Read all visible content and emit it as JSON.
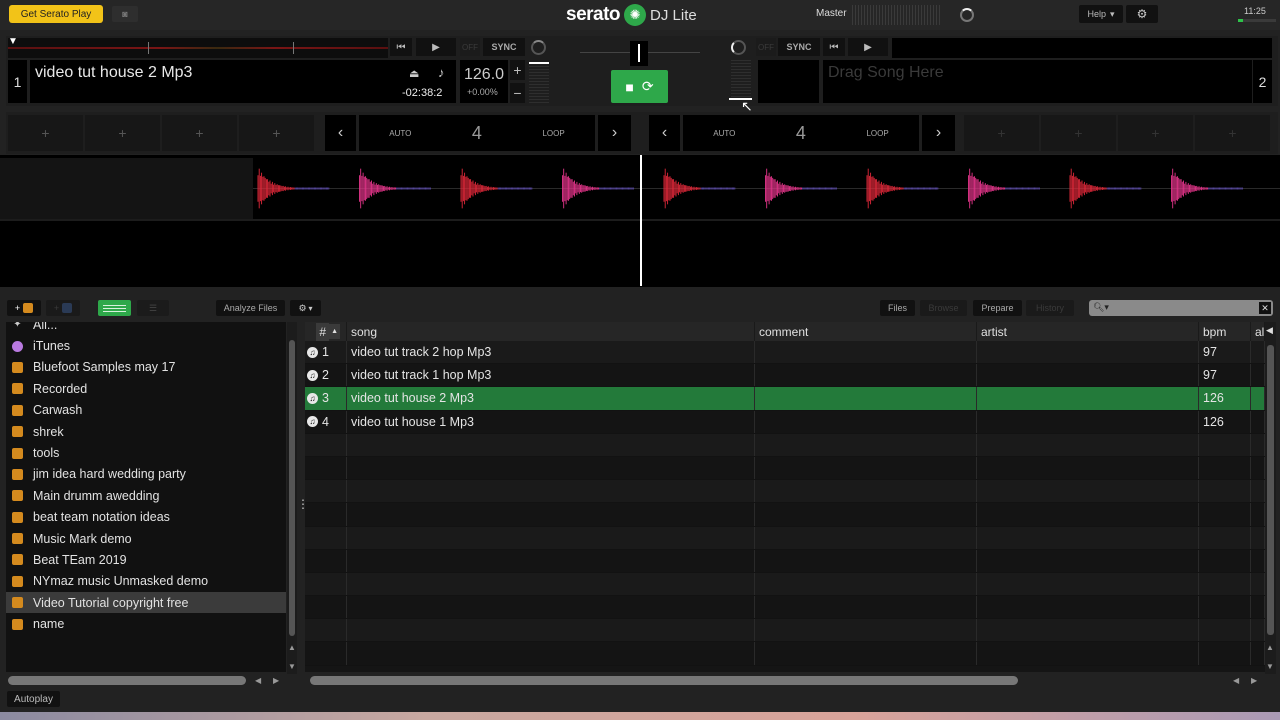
{
  "topbar": {
    "get_play_label": "Get Serato Play",
    "logo_brand": "serato",
    "logo_product": "DJ Lite",
    "master_label": "Master",
    "help_label": "Help",
    "clock": "11:25",
    "battery_level": 0.12
  },
  "deck1": {
    "number": "1",
    "title": "video tut house 2 Mp3",
    "time_remaining": "-02:38:2",
    "bpm": "126.0",
    "pitch": "+0.00%",
    "off_label": "OFF",
    "sync_label": "SYNC",
    "hotcues": [
      "+",
      "+",
      "+",
      "+"
    ],
    "loop": {
      "auto_label": "AUTO",
      "value": "4",
      "loop_label": "LOOP"
    }
  },
  "deck2": {
    "number": "2",
    "placeholder": "Drag Song Here",
    "off_label": "OFF",
    "sync_label": "SYNC",
    "hotcues": [
      "+",
      "+",
      "+",
      "+"
    ],
    "loop": {
      "auto_label": "AUTO",
      "value": "4",
      "loop_label": "LOOP"
    }
  },
  "crossfader": {
    "position": 0.5
  },
  "library_toolbar": {
    "analyze_label": "Analyze Files",
    "tabs": [
      {
        "label": "Files",
        "enabled": true
      },
      {
        "label": "Browse",
        "enabled": false
      },
      {
        "label": "Prepare",
        "enabled": true
      },
      {
        "label": "History",
        "enabled": false
      }
    ],
    "search_value": ""
  },
  "sidebar": {
    "items": [
      {
        "label": "All...",
        "icon": "all-icon"
      },
      {
        "label": "iTunes",
        "icon": "itunes-icon"
      },
      {
        "label": "Bluefoot Samples may 17",
        "icon": "crate-icon"
      },
      {
        "label": "Recorded",
        "icon": "crate-icon"
      },
      {
        "label": "Carwash",
        "icon": "crate-icon"
      },
      {
        "label": "shrek",
        "icon": "crate-icon"
      },
      {
        "label": "tools",
        "icon": "crate-icon"
      },
      {
        "label": "jim idea hard wedding party",
        "icon": "crate-icon"
      },
      {
        "label": "Main drumm awedding",
        "icon": "crate-icon"
      },
      {
        "label": "beat team notation ideas",
        "icon": "crate-icon"
      },
      {
        "label": "Music Mark demo",
        "icon": "crate-icon"
      },
      {
        "label": "Beat TEam 2019",
        "icon": "crate-icon"
      },
      {
        "label": "NYmaz music Unmasked demo",
        "icon": "crate-icon"
      },
      {
        "label": "Video Tutorial copyright free",
        "icon": "crate-icon",
        "selected": true
      },
      {
        "label": "name",
        "icon": "crate-icon"
      }
    ]
  },
  "table": {
    "columns": [
      "#",
      "song",
      "comment",
      "artist",
      "bpm",
      "all"
    ],
    "rows": [
      {
        "num": "1",
        "song": "video tut track 2 hop Mp3",
        "comment": "",
        "artist": "",
        "bpm": "97"
      },
      {
        "num": "2",
        "song": "video tut track 1 hop Mp3",
        "comment": "",
        "artist": "",
        "bpm": "97"
      },
      {
        "num": "3",
        "song": "video tut house 2 Mp3",
        "comment": "",
        "artist": "",
        "bpm": "126",
        "selected": true
      },
      {
        "num": "4",
        "song": "video tut house 1 Mp3",
        "comment": "",
        "artist": "",
        "bpm": "126"
      }
    ]
  },
  "footer": {
    "autoplay_label": "Autoplay"
  },
  "colors": {
    "accent_green": "#2ea84a",
    "selection_green": "#237a3a",
    "play_yellow": "#f2c318",
    "crate_orange": "#d48a1e"
  }
}
